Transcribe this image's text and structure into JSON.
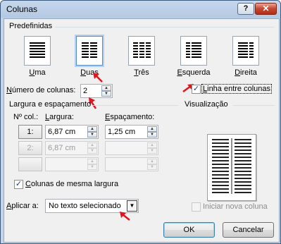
{
  "window": {
    "title": "Colunas",
    "help_label": "?",
    "close_label": "✕"
  },
  "presets": {
    "group_label": "Predefinidas",
    "items": [
      {
        "label": "Uma",
        "mnemonic": "U",
        "rest": "ma"
      },
      {
        "label": "Duas",
        "mnemonic": "D",
        "rest": "uas",
        "selected": true
      },
      {
        "label": "Três",
        "mnemonic": "T",
        "rest": "rês"
      },
      {
        "label": "Esquerda",
        "mnemonic": "E",
        "rest": "squerda"
      },
      {
        "label": "Direita",
        "mnemonic": "D",
        "rest": "ireita"
      }
    ]
  },
  "num_cols": {
    "label_mn": "N",
    "label_rest": "úmero de colunas:",
    "value": "2"
  },
  "line_between": {
    "label_mn": "L",
    "label_rest": "inha entre colunas",
    "checked": true
  },
  "width_spacing": {
    "group_label": "Largura e espaçamento",
    "col_header": "Nº col.:",
    "width_header_mn": "L",
    "width_header_rest": "argura:",
    "spacing_header_mn": "E",
    "spacing_header_rest": "spaçamento:",
    "rows": [
      {
        "col": "1:",
        "width": "6,87 cm",
        "spacing": "1,25 cm",
        "enabled": true
      },
      {
        "col": "2:",
        "width": "6,87 cm",
        "spacing": "",
        "enabled": false
      },
      {
        "col": "",
        "width": "",
        "spacing": "",
        "enabled": false
      }
    ]
  },
  "equal_width": {
    "label_mn": "C",
    "label_rest": "olunas de mesma largura",
    "checked": true
  },
  "preview": {
    "label": "Visualização"
  },
  "apply_to": {
    "label_mn": "A",
    "label_rest": "plicar a:",
    "value": "No texto selecionado"
  },
  "new_column": {
    "label": "Iniciar nova coluna",
    "checked": false
  },
  "buttons": {
    "ok": "OK",
    "cancel": "Cancelar"
  },
  "colors": {
    "highlight_arrow": "#e0141e",
    "title_bar": "#b9cde5",
    "close_button": "#c7452f"
  }
}
